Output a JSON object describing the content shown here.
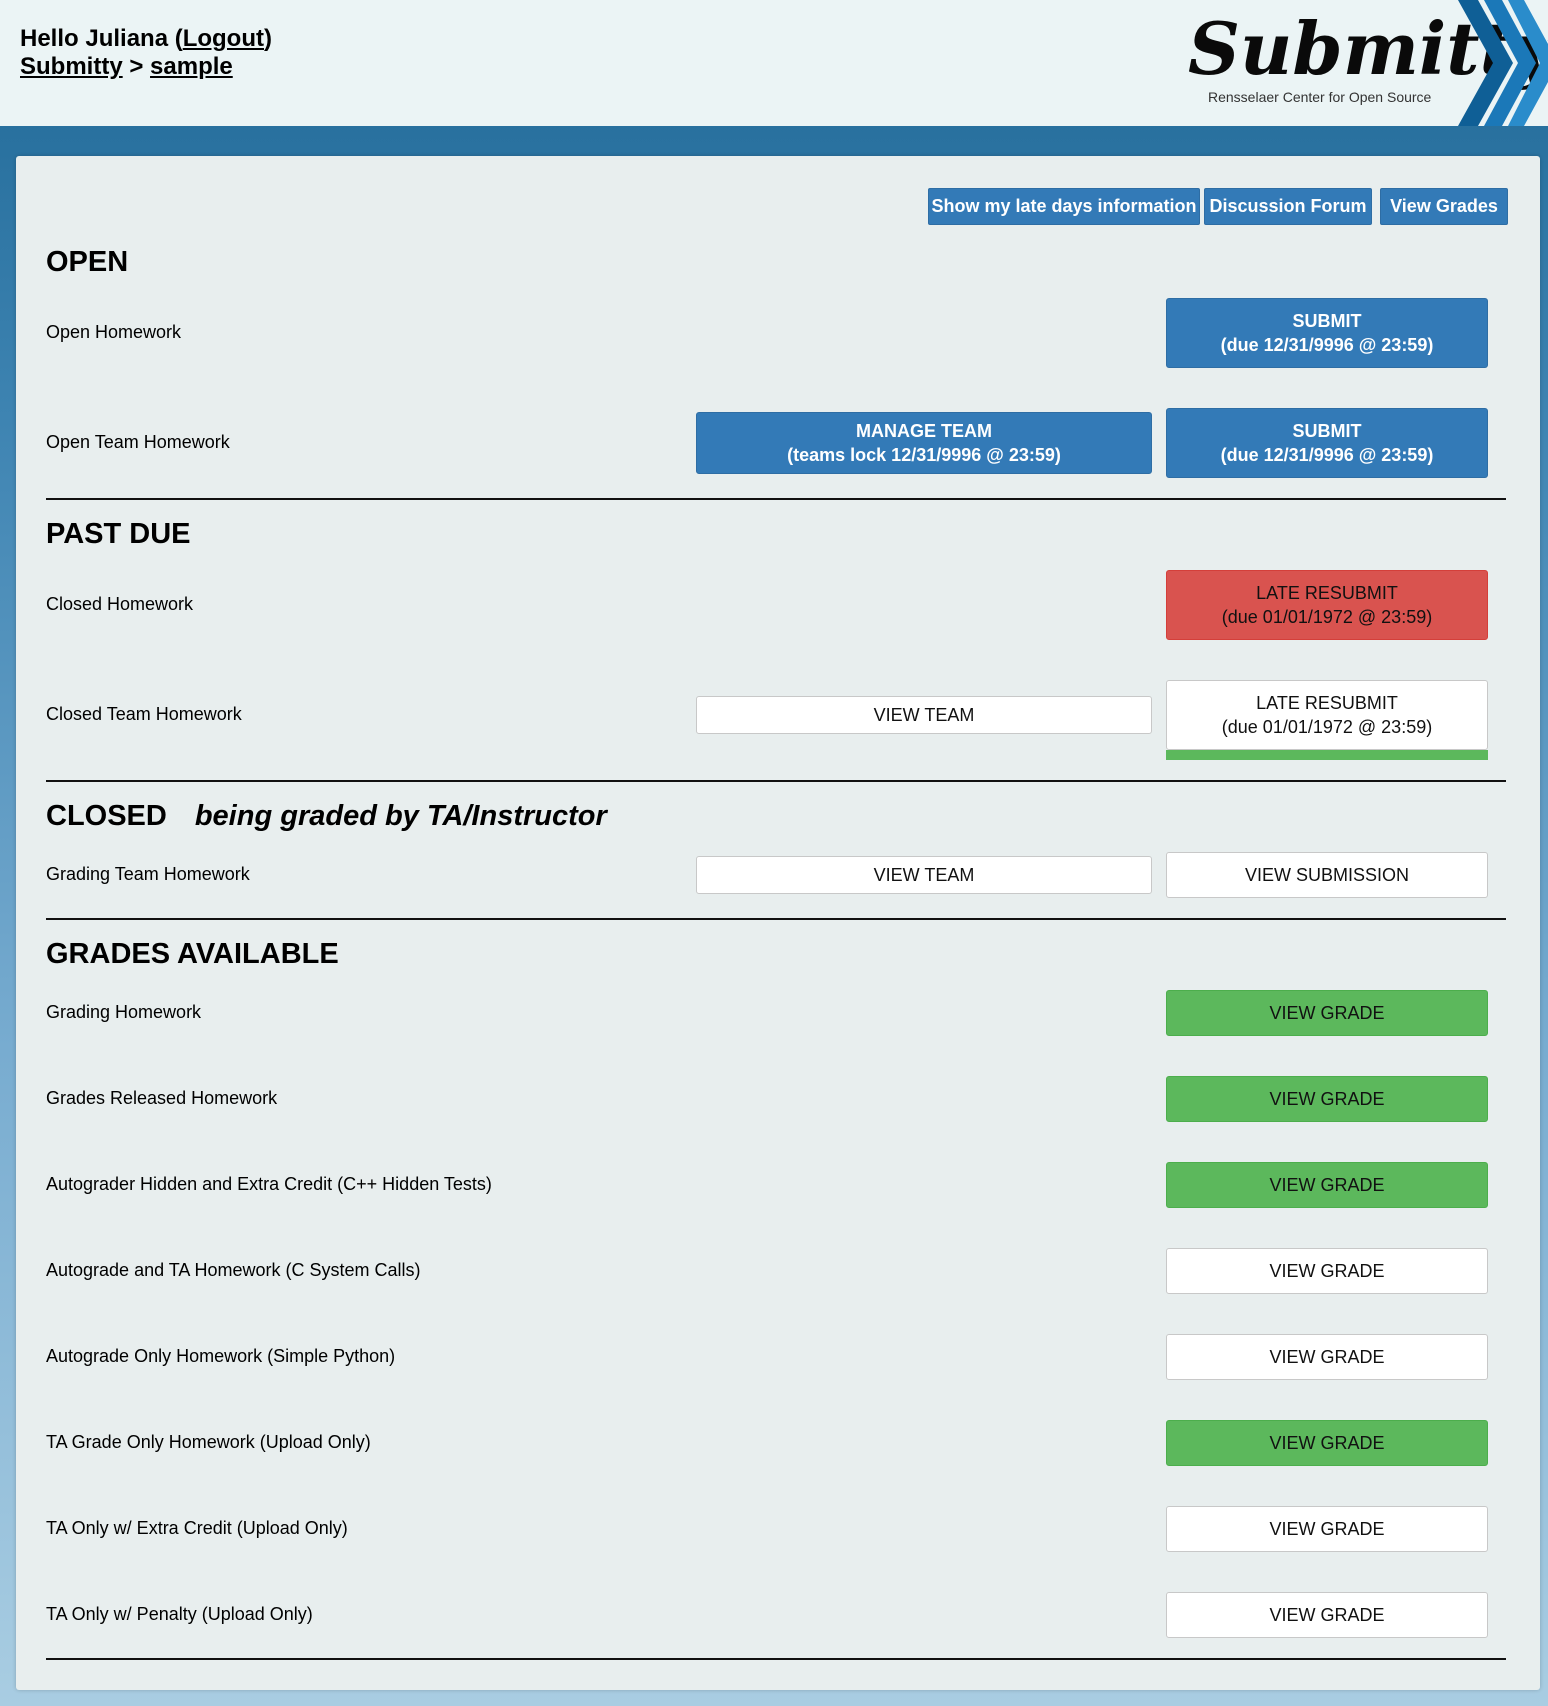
{
  "header": {
    "hello_prefix": "Hello Juliana (",
    "logout_label": "Logout",
    "hello_suffix": ")",
    "breadcrumb_root": "Submitty",
    "breadcrumb_sep": " > ",
    "breadcrumb_course": "sample",
    "logo_text": "Submitty",
    "logo_tagline": "Rensselaer Center for Open Source"
  },
  "toolbar": {
    "late_days_label": "Show my late days information",
    "forum_label": "Discussion Forum",
    "grades_label": "View Grades"
  },
  "sections": {
    "open": {
      "title": "OPEN",
      "rows": [
        {
          "name": "Open Homework",
          "submit_line1": "SUBMIT",
          "submit_line2": "(due 12/31/9996 @ 23:59)"
        },
        {
          "name": "Open Team Homework",
          "team_line1": "MANAGE TEAM",
          "team_line2": "(teams lock 12/31/9996 @ 23:59)",
          "submit_line1": "SUBMIT",
          "submit_line2": "(due 12/31/9996 @ 23:59)"
        }
      ]
    },
    "past_due": {
      "title": "PAST DUE",
      "rows": [
        {
          "name": "Closed Homework",
          "submit_line1": "LATE RESUBMIT",
          "submit_line2": "(due 01/01/1972 @ 23:59)"
        },
        {
          "name": "Closed Team Homework",
          "team_label": "VIEW TEAM",
          "submit_line1": "LATE RESUBMIT",
          "submit_line2": "(due 01/01/1972 @ 23:59)",
          "progress": 1.0
        }
      ]
    },
    "closed": {
      "title": "CLOSED",
      "subtitle": "being graded by TA/Instructor",
      "rows": [
        {
          "name": "Grading Team Homework",
          "team_label": "VIEW TEAM",
          "submission_label": "VIEW SUBMISSION"
        }
      ]
    },
    "grades": {
      "title": "GRADES AVAILABLE",
      "rows": [
        {
          "name": "Grading Homework",
          "button": "VIEW GRADE",
          "style": "green"
        },
        {
          "name": "Grades Released Homework",
          "button": "VIEW GRADE",
          "style": "green"
        },
        {
          "name": "Autograder Hidden and Extra Credit (C++ Hidden Tests)",
          "button": "VIEW GRADE",
          "style": "green"
        },
        {
          "name": "Autograde and TA Homework (C System Calls)",
          "button": "VIEW GRADE",
          "style": "white"
        },
        {
          "name": "Autograde Only Homework (Simple Python)",
          "button": "VIEW GRADE",
          "style": "white"
        },
        {
          "name": "TA Grade Only Homework (Upload Only)",
          "button": "VIEW GRADE",
          "style": "green"
        },
        {
          "name": "TA Only w/ Extra Credit (Upload Only)",
          "button": "VIEW GRADE",
          "style": "white"
        },
        {
          "name": "TA Only w/ Penalty (Upload Only)",
          "button": "VIEW GRADE",
          "style": "white"
        }
      ]
    }
  },
  "colors": {
    "primary_blue": "#337ab7",
    "danger_red": "#d9534f",
    "success_green": "#5cb85c",
    "logo_navy": "#0f3d67"
  }
}
